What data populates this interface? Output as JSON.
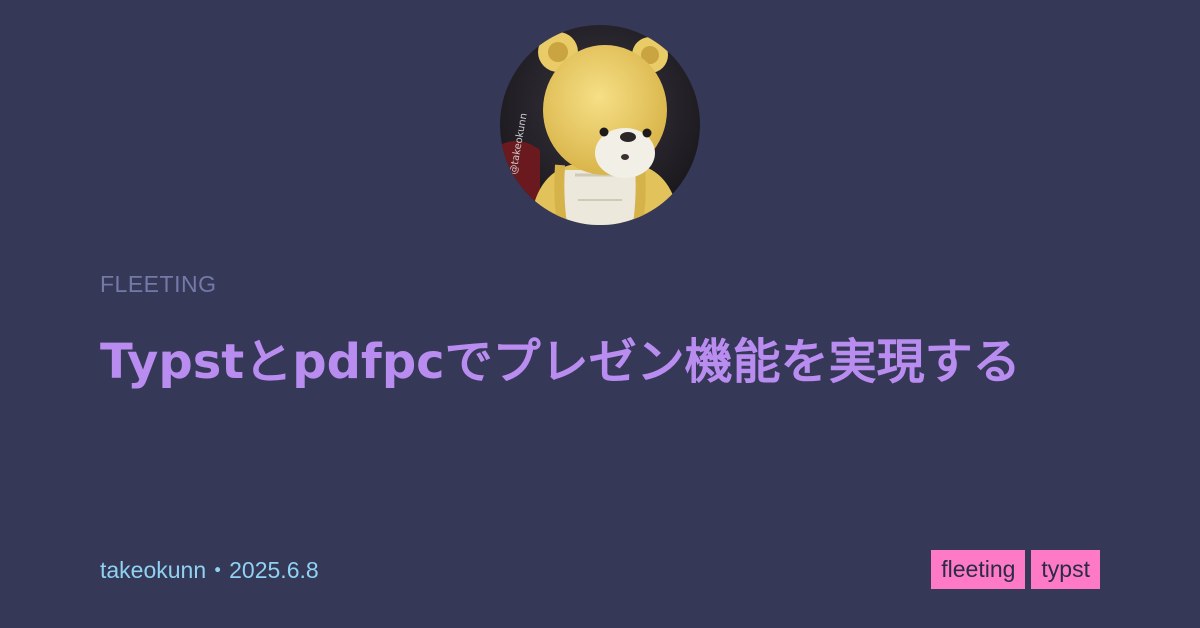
{
  "avatar": {
    "icon": "bear-figure-avatar",
    "watermark": "@takeokunn"
  },
  "category": "FLEETING",
  "title": "Typstとpdfpcでプレゼン機能を実現する",
  "meta": {
    "author": "takeokunn",
    "separator": "・",
    "date": "2025.6.8"
  },
  "tags": [
    "fleeting",
    "typst"
  ],
  "colors": {
    "background": "#363858",
    "title": "#b98cf0",
    "category": "#737aa8",
    "meta": "#8fd2f2",
    "tag_background": "#ff7ac6",
    "tag_text": "#2a2b45"
  }
}
